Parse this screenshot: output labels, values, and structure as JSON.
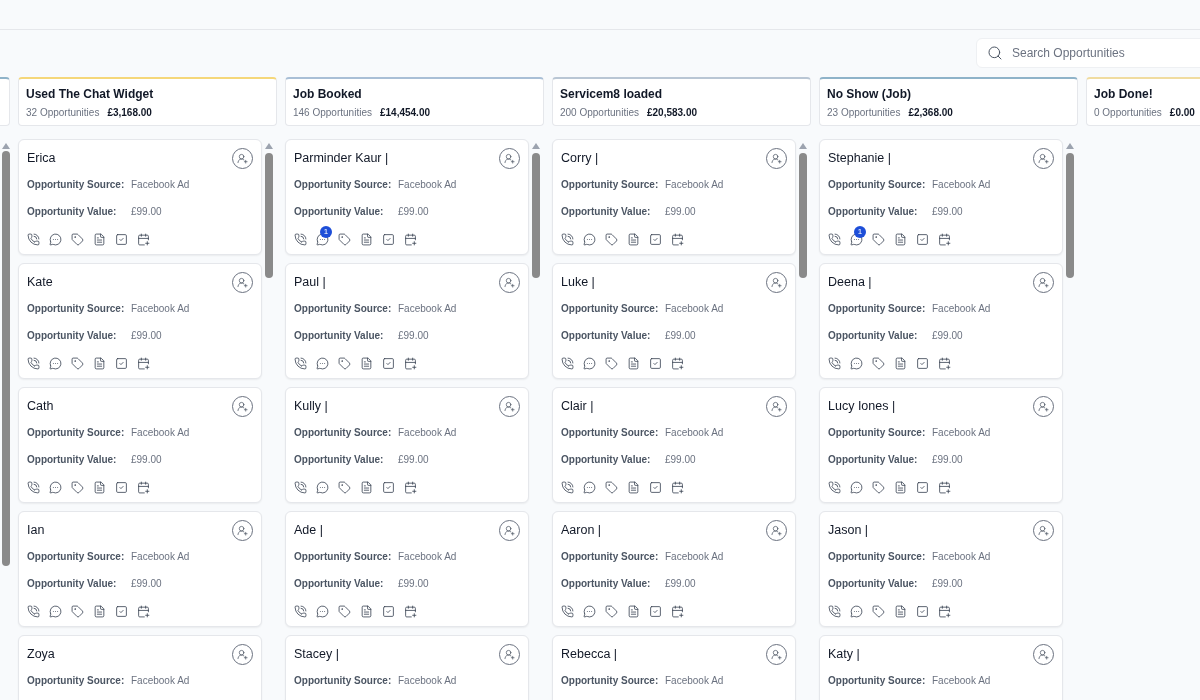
{
  "search": {
    "placeholder": "Search Opportunities"
  },
  "columns": [
    {
      "title": "Used The Chat Widget",
      "count": "32 Opportunities",
      "total": "£3,168.00",
      "color": "#f5d77a",
      "cards": [
        {
          "name": "Erica",
          "source_label": "Opportunity Source:",
          "source": "Facebook Ad",
          "value_label": "Opportunity Value:",
          "value": "£99.00"
        },
        {
          "name": "Kate",
          "source_label": "Opportunity Source:",
          "source": "Facebook Ad",
          "value_label": "Opportunity Value:",
          "value": "£99.00"
        },
        {
          "name": "Cath",
          "source_label": "Opportunity Source:",
          "source": "Facebook Ad",
          "value_label": "Opportunity Value:",
          "value": "£99.00"
        },
        {
          "name": "Ian",
          "source_label": "Opportunity Source:",
          "source": "Facebook Ad",
          "value_label": "Opportunity Value:",
          "value": "£99.00"
        },
        {
          "name": "Zoya",
          "source_label": "Opportunity Source:",
          "source": "Facebook Ad"
        }
      ]
    },
    {
      "title": "Job Booked",
      "count": "146 Opportunities",
      "total": "£14,454.00",
      "color": "#a9bfd6",
      "cards": [
        {
          "name": "Parminder Kaur |",
          "source_label": "Opportunity Source:",
          "source": "Facebook Ad",
          "value_label": "Opportunity Value:",
          "value": "£99.00",
          "badge": "1"
        },
        {
          "name": "Paul |",
          "source_label": "Opportunity Source:",
          "source": "Facebook Ad",
          "value_label": "Opportunity Value:",
          "value": "£99.00"
        },
        {
          "name": "Kully |",
          "source_label": "Opportunity Source:",
          "source": "Facebook Ad",
          "value_label": "Opportunity Value:",
          "value": "£99.00"
        },
        {
          "name": "Ade |",
          "source_label": "Opportunity Source:",
          "source": "Facebook Ad",
          "value_label": "Opportunity Value:",
          "value": "£99.00"
        },
        {
          "name": "Stacey |",
          "source_label": "Opportunity Source:",
          "source": "Facebook Ad"
        }
      ]
    },
    {
      "title": "Servicem8 loaded",
      "count": "200 Opportunities",
      "total": "£20,583.00",
      "color": "#b9c6d4",
      "cards": [
        {
          "name": "Corry |",
          "source_label": "Opportunity Source:",
          "source": "Facebook Ad",
          "value_label": "Opportunity Value:",
          "value": "£99.00"
        },
        {
          "name": "Luke |",
          "source_label": "Opportunity Source:",
          "source": "Facebook Ad",
          "value_label": "Opportunity Value:",
          "value": "£99.00"
        },
        {
          "name": "Clair |",
          "source_label": "Opportunity Source:",
          "source": "Facebook Ad",
          "value_label": "Opportunity Value:",
          "value": "£99.00"
        },
        {
          "name": "Aaron |",
          "source_label": "Opportunity Source:",
          "source": "Facebook Ad",
          "value_label": "Opportunity Value:",
          "value": "£99.00"
        },
        {
          "name": "Rebecca |",
          "source_label": "Opportunity Source:",
          "source": "Facebook Ad"
        }
      ]
    },
    {
      "title": "No Show (Job)",
      "count": "23 Opportunities",
      "total": "£2,368.00",
      "color": "#8fb3c9",
      "cards": [
        {
          "name": "Stephanie |",
          "source_label": "Opportunity Source:",
          "source": "Facebook Ad",
          "value_label": "Opportunity Value:",
          "value": "£99.00",
          "badge": "1"
        },
        {
          "name": "Deena |",
          "source_label": "Opportunity Source:",
          "source": "Facebook Ad",
          "value_label": "Opportunity Value:",
          "value": "£99.00"
        },
        {
          "name": "Lucy Iones |",
          "source_label": "Opportunity Source:",
          "source": "Facebook Ad",
          "value_label": "Opportunity Value:",
          "value": "£99.00"
        },
        {
          "name": "Jason |",
          "source_label": "Opportunity Source:",
          "source": "Facebook Ad",
          "value_label": "Opportunity Value:",
          "value": "£99.00"
        },
        {
          "name": "Katy |",
          "source_label": "Opportunity Source:",
          "source": "Facebook Ad"
        }
      ]
    },
    {
      "title": "Job Done!",
      "count": "0 Opportunities",
      "total": "£0.00",
      "color": "#f0dca0"
    }
  ]
}
